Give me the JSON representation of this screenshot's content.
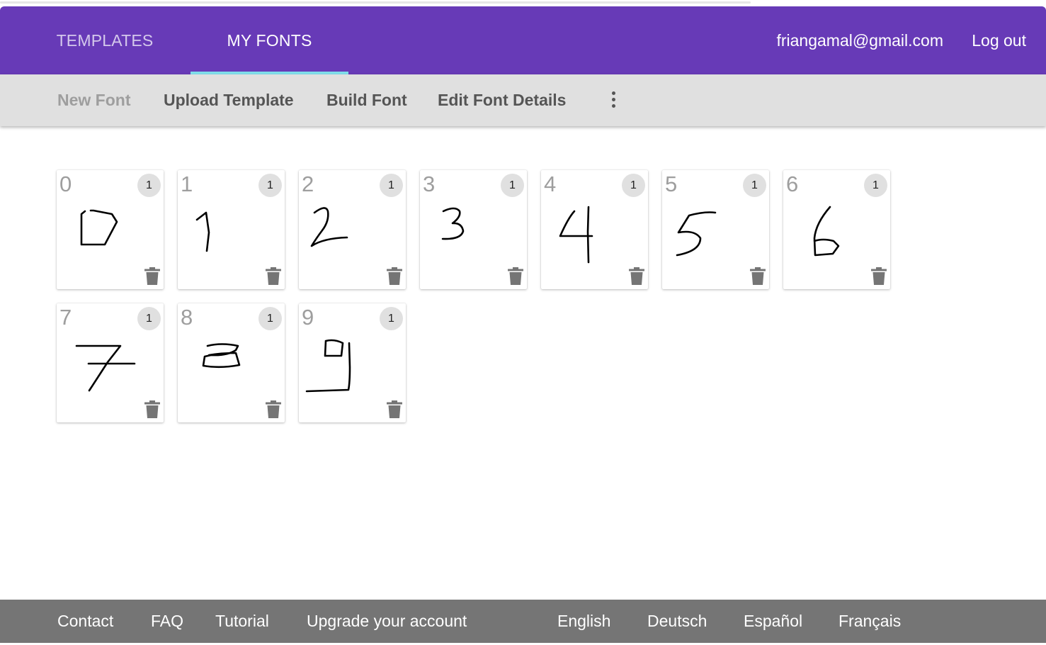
{
  "nav": {
    "tabs": [
      {
        "label": "TEMPLATES",
        "active": false
      },
      {
        "label": "MY FONTS",
        "active": true
      }
    ],
    "email": "friangamal@gmail.com",
    "logout": "Log out"
  },
  "toolbar": {
    "new_font": "New Font",
    "upload_template": "Upload Template",
    "build_font": "Build Font",
    "edit_font_details": "Edit Font Details",
    "more_icon": "more-vert-icon"
  },
  "glyphs": [
    {
      "label": "0",
      "count": "1"
    },
    {
      "label": "1",
      "count": "1"
    },
    {
      "label": "2",
      "count": "1"
    },
    {
      "label": "3",
      "count": "1"
    },
    {
      "label": "4",
      "count": "1"
    },
    {
      "label": "5",
      "count": "1"
    },
    {
      "label": "6",
      "count": "1"
    },
    {
      "label": "7",
      "count": "1"
    },
    {
      "label": "8",
      "count": "1"
    },
    {
      "label": "9",
      "count": "1"
    }
  ],
  "footer": {
    "contact": "Contact",
    "faq": "FAQ",
    "tutorial": "Tutorial",
    "upgrade": "Upgrade your account",
    "english": "English",
    "deutsch": "Deutsch",
    "espanol": "Español",
    "francais": "Français"
  },
  "colors": {
    "appbar": "#673ab7",
    "tab_indicator": "#80deea",
    "toolbar": "#e0e0e0",
    "footer": "#757575"
  }
}
